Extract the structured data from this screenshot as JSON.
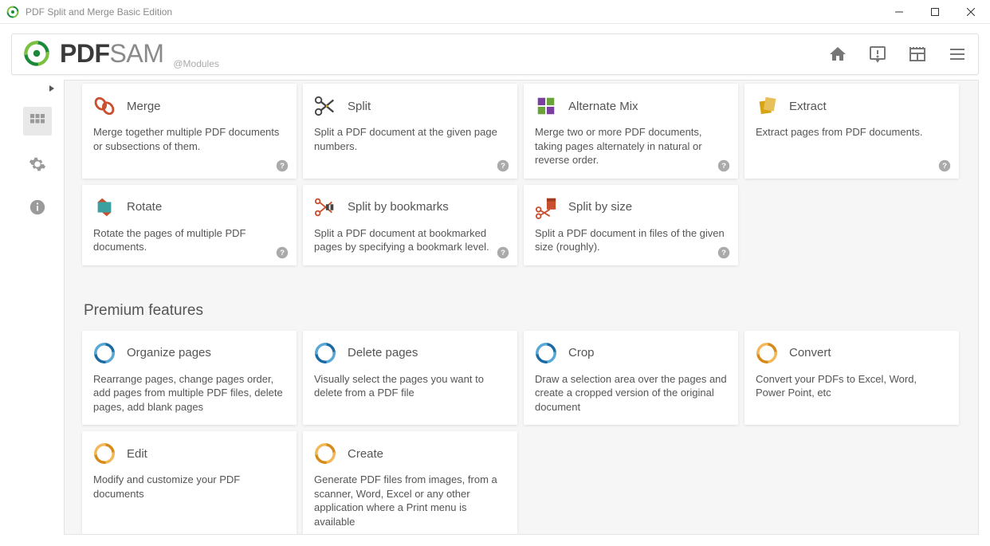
{
  "window": {
    "title": "PDF Split and Merge Basic Edition"
  },
  "brand": {
    "pdf": "PDF",
    "sam": "SAM",
    "sub": "@Modules"
  },
  "section_premium": "Premium features",
  "cards": [
    {
      "title": "Merge",
      "desc": "Merge together multiple PDF documents or subsections of them."
    },
    {
      "title": "Split",
      "desc": "Split a PDF document at the given page numbers."
    },
    {
      "title": "Alternate Mix",
      "desc": "Merge two or more PDF documents, taking pages alternately in natural or reverse order."
    },
    {
      "title": "Extract",
      "desc": "Extract pages from PDF documents."
    },
    {
      "title": "Rotate",
      "desc": "Rotate the pages of multiple PDF documents."
    },
    {
      "title": "Split by bookmarks",
      "desc": "Split a PDF document at bookmarked pages by specifying a bookmark level."
    },
    {
      "title": "Split by size",
      "desc": "Split a PDF document in files of the given size (roughly)."
    }
  ],
  "premium_cards": [
    {
      "title": "Organize pages",
      "desc": "Rearrange pages, change pages order, add pages from multiple PDF files, delete pages, add blank pages"
    },
    {
      "title": "Delete pages",
      "desc": "Visually select the pages you want to delete from a PDF file"
    },
    {
      "title": "Crop",
      "desc": "Draw a selection area over the pages and create a cropped version of the original document"
    },
    {
      "title": "Convert",
      "desc": "Convert your PDFs to Excel, Word, Power Point, etc"
    },
    {
      "title": "Edit",
      "desc": "Modify and customize your PDF documents"
    },
    {
      "title": "Create",
      "desc": "Generate PDF files from images, from a scanner, Word, Excel or any other application where a Print menu is available"
    }
  ]
}
